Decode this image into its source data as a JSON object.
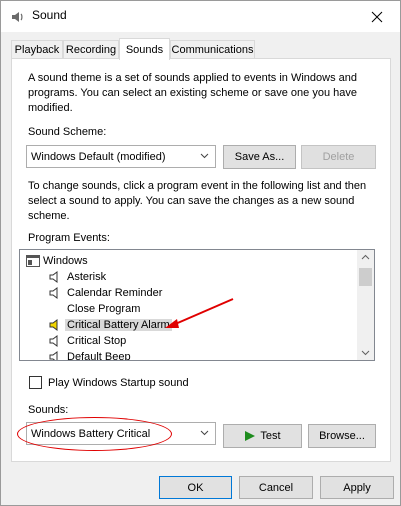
{
  "window": {
    "title": "Sound",
    "icon": "speaker-icon",
    "close_icon": "close-icon"
  },
  "tabs": [
    {
      "label": "Playback"
    },
    {
      "label": "Recording"
    },
    {
      "label": "Sounds"
    },
    {
      "label": "Communications"
    }
  ],
  "sounds_tab": {
    "intro": "A sound theme is a set of sounds applied to events in Windows and programs.  You can select an existing scheme or save one you have modified.",
    "intro_lines": [
      "A sound theme is a set of sounds applied to events in Windows and",
      "programs.  You can select an existing scheme or save one you have",
      "modified."
    ],
    "scheme_label": "Sound Scheme:",
    "scheme_value": "Windows Default (modified)",
    "save_as_label": "Save As...",
    "delete_label": "Delete",
    "change_lines": [
      "To change sounds, click a program event in the following list and then",
      "select a sound to apply.  You can save the changes as a new sound",
      "scheme."
    ],
    "events_label": "Program Events:",
    "events": [
      {
        "label": "Windows",
        "icon": "windows-group-icon",
        "indent": 0
      },
      {
        "label": "Asterisk",
        "icon": "speaker-icon",
        "indent": 1
      },
      {
        "label": "Calendar Reminder",
        "icon": "speaker-icon",
        "indent": 1
      },
      {
        "label": "Close Program",
        "icon": "",
        "indent": 1
      },
      {
        "label": "Critical Battery Alarm",
        "icon": "speaker-yellow-icon",
        "indent": 1,
        "selected": true
      },
      {
        "label": "Critical Stop",
        "icon": "speaker-icon",
        "indent": 1
      },
      {
        "label": "Default Beep",
        "icon": "speaker-icon",
        "indent": 1
      }
    ],
    "startup_checkbox_label": "Play Windows Startup sound",
    "startup_checked": false,
    "sounds_label": "Sounds:",
    "sound_value": "Windows Battery Critical",
    "test_label": "Test",
    "browse_label": "Browse..."
  },
  "footer": {
    "ok_label": "OK",
    "cancel_label": "Cancel",
    "apply_label": "Apply"
  },
  "colors": {
    "annotation": "#e00000",
    "play_green": "#1e8c1e",
    "speaker_yellow": "#f2d600"
  }
}
